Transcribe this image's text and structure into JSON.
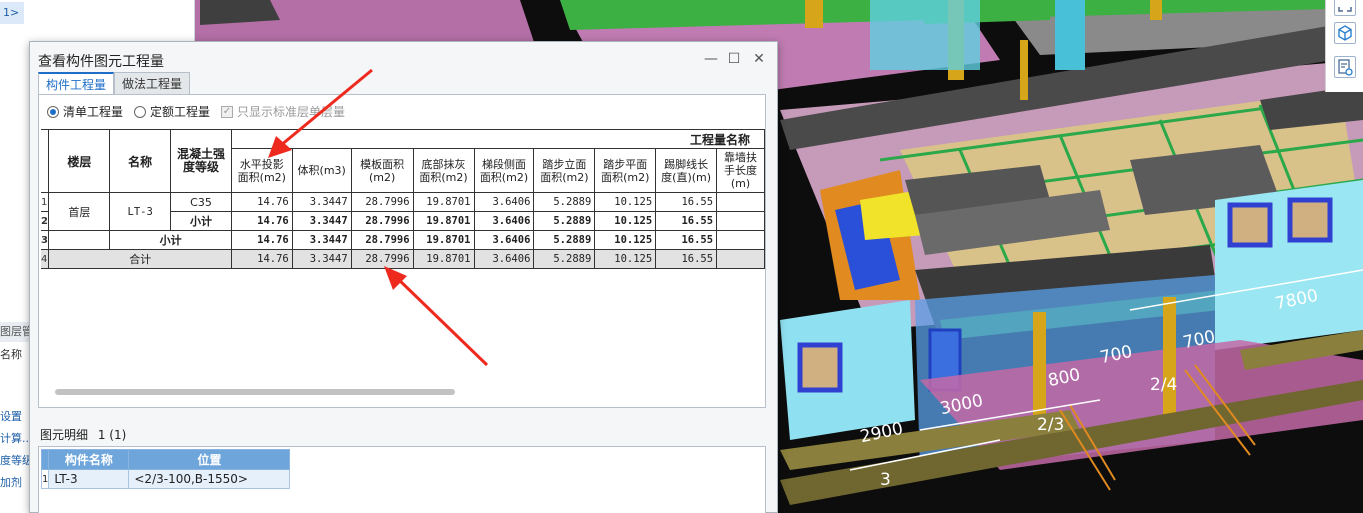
{
  "left_panel": {
    "tree_item_label": "1>",
    "section_title": "图层管",
    "field_label": "名称",
    "links": [
      "设置",
      "计算...",
      "度等级",
      "加剂"
    ]
  },
  "viewport": {
    "dimension_labels": [
      "7800",
      "700",
      "700",
      "800",
      "3000",
      "2900",
      "2/3",
      "2/4",
      "3"
    ]
  },
  "dialog": {
    "title": "查看构件图元工程量",
    "tabs": [
      {
        "label": "构件工程量",
        "active": true
      },
      {
        "label": "做法工程量",
        "active": false
      }
    ],
    "options": {
      "list_quantity": "清单工程量",
      "quota_quantity": "定额工程量",
      "standard_floor_only": "只显示标准层单层量"
    },
    "table": {
      "group_header": "工程量名称",
      "headers": {
        "floor": "楼层",
        "name": "名称",
        "concrete_grade": "混凝土强度等级",
        "horiz_proj_area": "水平投影面积(m2)",
        "volume": "体积(m3)",
        "formwork_area": "模板面积(m2)",
        "bottom_plaster_area": "底部抹灰面积(m2)",
        "stair_side_area": "梯段侧面面积(m2)",
        "riser_area": "踏步立面面积(m2)",
        "tread_area": "踏步平面面积(m2)",
        "skirting_length": "踢脚线长度(直)(m)",
        "wall_handrail_length": "靠墙扶手长度(m)"
      },
      "row_numbers": [
        "1",
        "2",
        "3",
        "4"
      ],
      "floor_value": "首层",
      "name_value": "LT-3",
      "grade_value": "C35",
      "subtotal_label": "小计",
      "total_label": "合计",
      "values": [
        "14.76",
        "3.3447",
        "28.7996",
        "19.8701",
        "3.6406",
        "5.2889",
        "10.125",
        "16.55",
        ""
      ]
    },
    "detail": {
      "label": "图元明细",
      "count": "1 (1)",
      "headers": {
        "component_name": "构件名称",
        "position": "位置"
      },
      "rows": [
        {
          "row": "1",
          "name": "LT-3",
          "position": "<2/3-100,B-1550>"
        }
      ]
    }
  }
}
